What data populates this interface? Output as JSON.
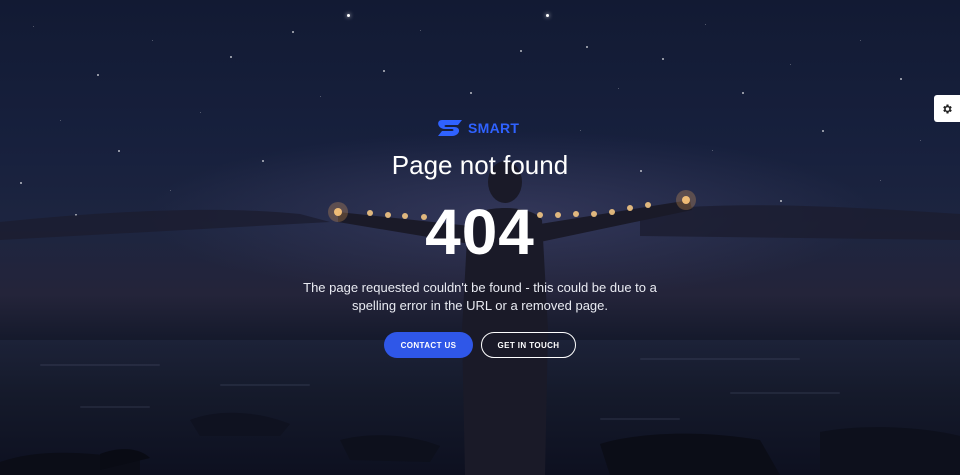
{
  "brand": {
    "name": "SMART",
    "color": "#2f62ff"
  },
  "error": {
    "title": "Page not found",
    "code": "404",
    "description": "The page requested couldn't be found - this could be due to a spelling error in the URL or a removed page."
  },
  "actions": {
    "primary_label": "CONTACT US",
    "secondary_label": "GET IN TOUCH",
    "primary_color": "#2f57e8"
  },
  "settings": {
    "icon": "gear-icon"
  }
}
